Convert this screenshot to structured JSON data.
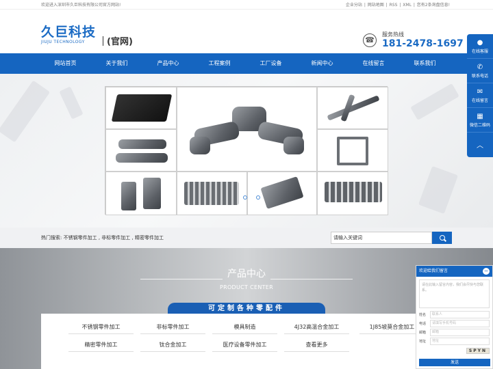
{
  "topbar": {
    "welcome": "欢迎进入深圳市久巨科技有限公司官方网站!",
    "links": [
      "企业分站",
      "网站地图",
      "RSS",
      "XML",
      "您有2条询盘信息!"
    ]
  },
  "header": {
    "logo_cn": "久巨科技",
    "logo_en": "JIUJU TECHNOLOGY",
    "official": "(官网)",
    "hotline_label": "服务热线",
    "hotline_number": "181-2478-1697"
  },
  "nav": [
    "网站首页",
    "关于我们",
    "产品中心",
    "工程案例",
    "工厂设备",
    "新闻中心",
    "在线留言",
    "联系我们"
  ],
  "search": {
    "hot_label": "热门搜索:",
    "hot_terms": "不锈钢零件加工 , 非标零件加工 , 精密零件加工",
    "placeholder": "请输入关键词"
  },
  "products": {
    "title": "产品中心",
    "subtitle": "PRODUCT CENTER",
    "ribbon": "可定制各种零配件",
    "items": [
      "不锈钢零件加工",
      "非标零件加工",
      "模具制造",
      "4J32高温合金加工",
      "1J85坡莫合金加工",
      "精密零件加工",
      "钛合金加工",
      "医疗设备零件加工",
      "查看更多"
    ]
  },
  "rightbar": [
    {
      "label": "在线客服",
      "icon": "chat-bubble-icon"
    },
    {
      "label": "联系电话",
      "icon": "phone-icon"
    },
    {
      "label": "在线留言",
      "icon": "message-icon"
    },
    {
      "label": "微信二维码",
      "icon": "qrcode-icon"
    },
    {
      "label": "",
      "icon": "arrow-up-icon"
    }
  ],
  "chat": {
    "title": "欢迎给我们留言",
    "message_placeholder": "请在此输入留言内容，我们会尽快与您联系。",
    "fields": [
      {
        "label": "姓名",
        "placeholder": "联系人"
      },
      {
        "label": "电话",
        "placeholder": "请填写手机号码"
      },
      {
        "label": "邮箱",
        "placeholder": "邮箱"
      },
      {
        "label": "地址",
        "placeholder": "地址"
      }
    ],
    "captcha": "SPYN",
    "send": "发送"
  },
  "colors": {
    "primary": "#1565c0",
    "brand": "#1b6bc4"
  }
}
